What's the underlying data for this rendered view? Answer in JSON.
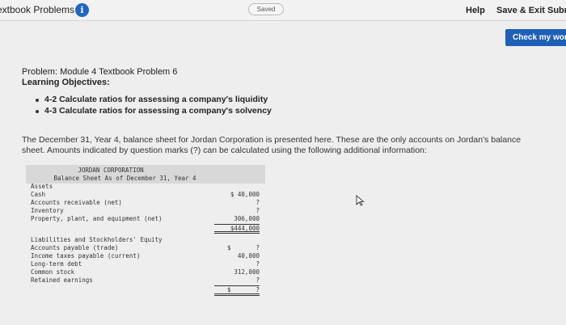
{
  "header": {
    "title": "extbook Problems",
    "info_icon": "info-icon",
    "saved": "Saved",
    "help": "Help",
    "save_exit": "Save & Exit",
    "submit": "Subr"
  },
  "check_button": "Check my work",
  "problem": {
    "title": "Problem: Module 4 Textbook Problem 6",
    "objectives_label": "Learning Objectives:",
    "objectives": [
      "4-2 Calculate ratios for assessing a company's liquidity",
      "4-3 Calculate ratios for assessing a company's solvency"
    ],
    "intro": "The December 31, Year 4, balance sheet for Jordan Corporation is presented here. These are the only accounts on Jordan's balance sheet. Amounts indicated by question marks (?) can be calculated using the following additional information:"
  },
  "balance_sheet": {
    "corp_name": "JORDAN CORPORATION",
    "subtitle": "Balance Sheet As of December 31, Year 4",
    "assets_label": "Assets",
    "assets": [
      {
        "label": "Cash",
        "amount": "$ 40,000"
      },
      {
        "label": "Accounts receivable (net)",
        "amount": "?"
      },
      {
        "label": "Inventory",
        "amount": "?"
      },
      {
        "label": "Property, plant, and equipment (net)",
        "amount": "306,000"
      }
    ],
    "total_assets": "$444,000",
    "liab_label": "Liabilities and Stockholders' Equity",
    "liabilities": [
      {
        "label": "Accounts payable (trade)",
        "amount": "?",
        "dollar": "$"
      },
      {
        "label": "Income taxes payable (current)",
        "amount": "40,000"
      },
      {
        "label": "Long-term debt",
        "amount": "?"
      },
      {
        "label": "Common stock",
        "amount": "312,000"
      },
      {
        "label": "Retained earnings",
        "amount": "?"
      }
    ],
    "total_liab_dollar": "$",
    "total_liab": "?"
  }
}
